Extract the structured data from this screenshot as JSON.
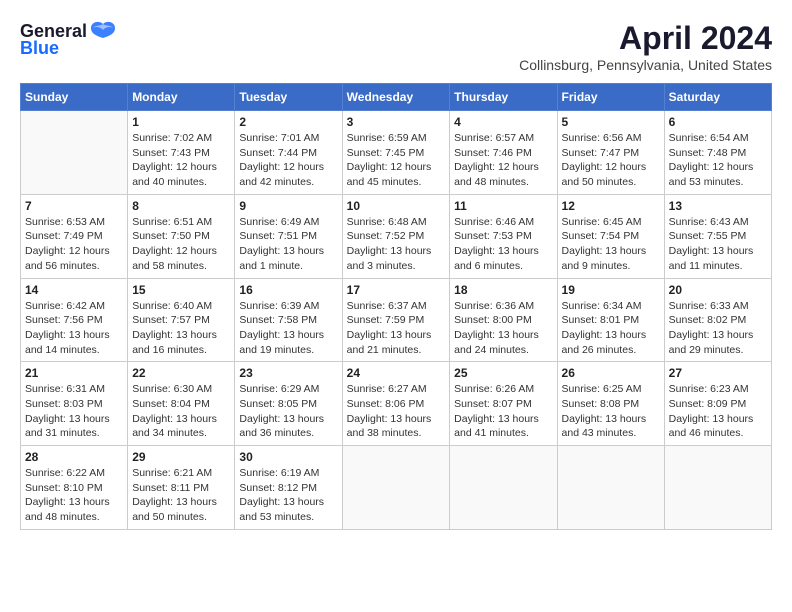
{
  "header": {
    "logo_general": "General",
    "logo_blue": "Blue",
    "month_year": "April 2024",
    "location": "Collinsburg, Pennsylvania, United States"
  },
  "weekdays": [
    "Sunday",
    "Monday",
    "Tuesday",
    "Wednesday",
    "Thursday",
    "Friday",
    "Saturday"
  ],
  "weeks": [
    [
      {
        "day": "",
        "info": ""
      },
      {
        "day": "1",
        "info": "Sunrise: 7:02 AM\nSunset: 7:43 PM\nDaylight: 12 hours\nand 40 minutes."
      },
      {
        "day": "2",
        "info": "Sunrise: 7:01 AM\nSunset: 7:44 PM\nDaylight: 12 hours\nand 42 minutes."
      },
      {
        "day": "3",
        "info": "Sunrise: 6:59 AM\nSunset: 7:45 PM\nDaylight: 12 hours\nand 45 minutes."
      },
      {
        "day": "4",
        "info": "Sunrise: 6:57 AM\nSunset: 7:46 PM\nDaylight: 12 hours\nand 48 minutes."
      },
      {
        "day": "5",
        "info": "Sunrise: 6:56 AM\nSunset: 7:47 PM\nDaylight: 12 hours\nand 50 minutes."
      },
      {
        "day": "6",
        "info": "Sunrise: 6:54 AM\nSunset: 7:48 PM\nDaylight: 12 hours\nand 53 minutes."
      }
    ],
    [
      {
        "day": "7",
        "info": "Sunrise: 6:53 AM\nSunset: 7:49 PM\nDaylight: 12 hours\nand 56 minutes."
      },
      {
        "day": "8",
        "info": "Sunrise: 6:51 AM\nSunset: 7:50 PM\nDaylight: 12 hours\nand 58 minutes."
      },
      {
        "day": "9",
        "info": "Sunrise: 6:49 AM\nSunset: 7:51 PM\nDaylight: 13 hours\nand 1 minute."
      },
      {
        "day": "10",
        "info": "Sunrise: 6:48 AM\nSunset: 7:52 PM\nDaylight: 13 hours\nand 3 minutes."
      },
      {
        "day": "11",
        "info": "Sunrise: 6:46 AM\nSunset: 7:53 PM\nDaylight: 13 hours\nand 6 minutes."
      },
      {
        "day": "12",
        "info": "Sunrise: 6:45 AM\nSunset: 7:54 PM\nDaylight: 13 hours\nand 9 minutes."
      },
      {
        "day": "13",
        "info": "Sunrise: 6:43 AM\nSunset: 7:55 PM\nDaylight: 13 hours\nand 11 minutes."
      }
    ],
    [
      {
        "day": "14",
        "info": "Sunrise: 6:42 AM\nSunset: 7:56 PM\nDaylight: 13 hours\nand 14 minutes."
      },
      {
        "day": "15",
        "info": "Sunrise: 6:40 AM\nSunset: 7:57 PM\nDaylight: 13 hours\nand 16 minutes."
      },
      {
        "day": "16",
        "info": "Sunrise: 6:39 AM\nSunset: 7:58 PM\nDaylight: 13 hours\nand 19 minutes."
      },
      {
        "day": "17",
        "info": "Sunrise: 6:37 AM\nSunset: 7:59 PM\nDaylight: 13 hours\nand 21 minutes."
      },
      {
        "day": "18",
        "info": "Sunrise: 6:36 AM\nSunset: 8:00 PM\nDaylight: 13 hours\nand 24 minutes."
      },
      {
        "day": "19",
        "info": "Sunrise: 6:34 AM\nSunset: 8:01 PM\nDaylight: 13 hours\nand 26 minutes."
      },
      {
        "day": "20",
        "info": "Sunrise: 6:33 AM\nSunset: 8:02 PM\nDaylight: 13 hours\nand 29 minutes."
      }
    ],
    [
      {
        "day": "21",
        "info": "Sunrise: 6:31 AM\nSunset: 8:03 PM\nDaylight: 13 hours\nand 31 minutes."
      },
      {
        "day": "22",
        "info": "Sunrise: 6:30 AM\nSunset: 8:04 PM\nDaylight: 13 hours\nand 34 minutes."
      },
      {
        "day": "23",
        "info": "Sunrise: 6:29 AM\nSunset: 8:05 PM\nDaylight: 13 hours\nand 36 minutes."
      },
      {
        "day": "24",
        "info": "Sunrise: 6:27 AM\nSunset: 8:06 PM\nDaylight: 13 hours\nand 38 minutes."
      },
      {
        "day": "25",
        "info": "Sunrise: 6:26 AM\nSunset: 8:07 PM\nDaylight: 13 hours\nand 41 minutes."
      },
      {
        "day": "26",
        "info": "Sunrise: 6:25 AM\nSunset: 8:08 PM\nDaylight: 13 hours\nand 43 minutes."
      },
      {
        "day": "27",
        "info": "Sunrise: 6:23 AM\nSunset: 8:09 PM\nDaylight: 13 hours\nand 46 minutes."
      }
    ],
    [
      {
        "day": "28",
        "info": "Sunrise: 6:22 AM\nSunset: 8:10 PM\nDaylight: 13 hours\nand 48 minutes."
      },
      {
        "day": "29",
        "info": "Sunrise: 6:21 AM\nSunset: 8:11 PM\nDaylight: 13 hours\nand 50 minutes."
      },
      {
        "day": "30",
        "info": "Sunrise: 6:19 AM\nSunset: 8:12 PM\nDaylight: 13 hours\nand 53 minutes."
      },
      {
        "day": "",
        "info": ""
      },
      {
        "day": "",
        "info": ""
      },
      {
        "day": "",
        "info": ""
      },
      {
        "day": "",
        "info": ""
      }
    ]
  ]
}
